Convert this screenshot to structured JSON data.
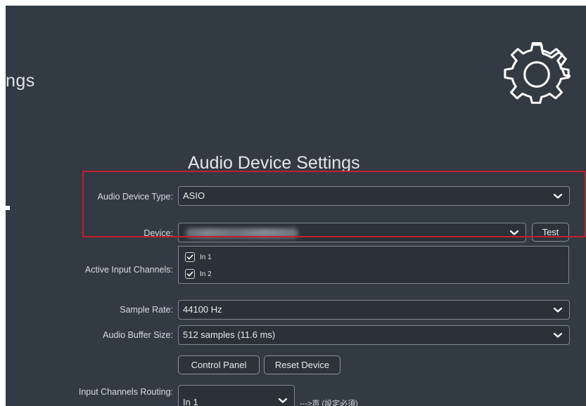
{
  "header": {
    "title_fragment": "ngs",
    "settings_icon": "gear-icon"
  },
  "audio_settings": {
    "title": "Audio Device Settings",
    "device_type": {
      "label": "Audio Device Type:",
      "value": "ASIO"
    },
    "device": {
      "label": "Device:",
      "value": "",
      "test_label": "Test"
    },
    "active_inputs": {
      "label": "Active Input Channels:",
      "channels": [
        {
          "label": "In 1",
          "checked": true
        },
        {
          "label": "In 2",
          "checked": true
        }
      ]
    },
    "sample_rate": {
      "label": "Sample Rate:",
      "value": "44100 Hz"
    },
    "buffer_size": {
      "label": "Audio Buffer Size:",
      "value": "512 samples (11.6 ms)"
    },
    "buttons": {
      "control_panel": "Control Panel",
      "reset_device": "Reset Device"
    },
    "routing": {
      "label": "Input Channels Routing:",
      "value": "In 1",
      "note": "--->声 (設定必須)"
    }
  },
  "colors": {
    "background": "#323a43",
    "highlight": "#c81e2c",
    "border": "#7f8a95"
  }
}
